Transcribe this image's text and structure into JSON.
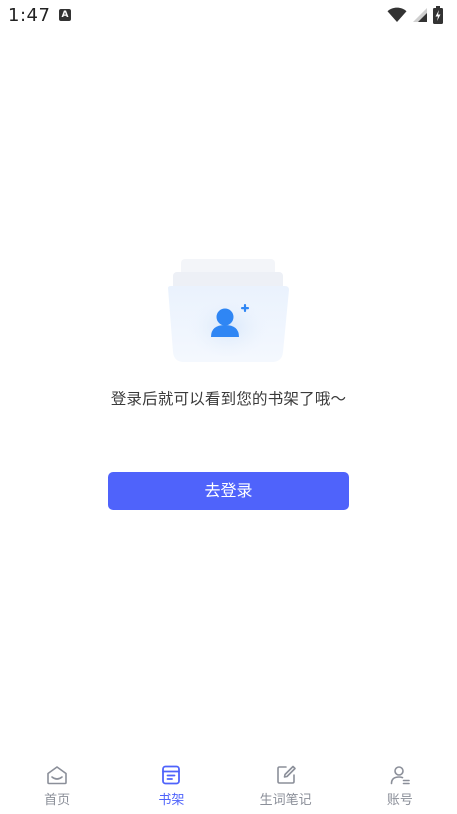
{
  "status_bar": {
    "time": "1:47",
    "notification_badge": "A"
  },
  "empty_state": {
    "message": "登录后就可以看到您的书架了哦～",
    "login_button_label": "去登录"
  },
  "bottom_nav": {
    "active_index": 1,
    "items": [
      {
        "label": "首页",
        "icon": "home-icon"
      },
      {
        "label": "书架",
        "icon": "bookshelf-icon"
      },
      {
        "label": "生词笔记",
        "icon": "note-edit-icon"
      },
      {
        "label": "账号",
        "icon": "account-icon"
      }
    ]
  },
  "colors": {
    "accent": "#4f63fb",
    "nav_inactive": "#8b8f99",
    "text": "#3a3a3a"
  }
}
